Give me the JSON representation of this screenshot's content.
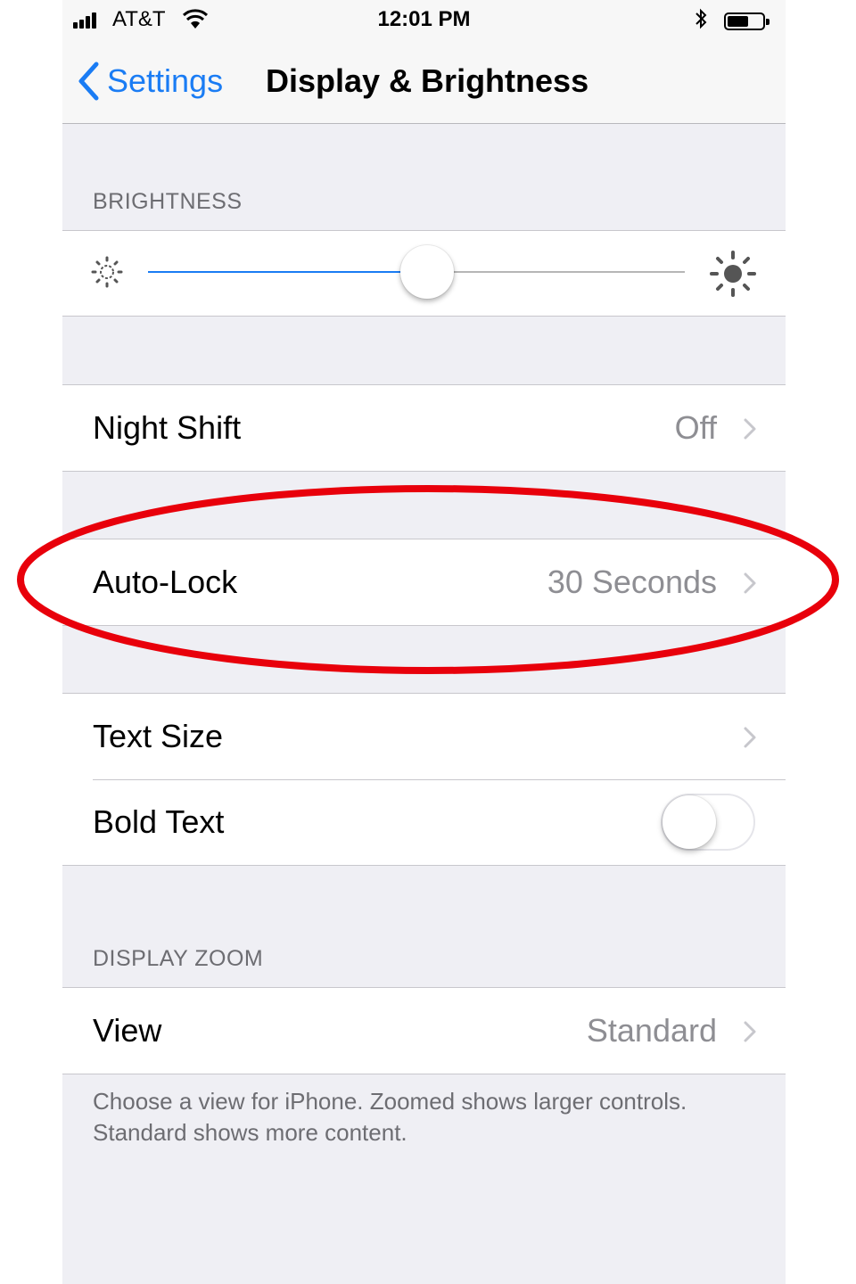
{
  "status_bar": {
    "carrier": "AT&T",
    "time": "12:01 PM",
    "bluetooth_icon": "bluetooth-icon",
    "battery_level": 0.6
  },
  "nav": {
    "back_label": "Settings",
    "title": "Display & Brightness"
  },
  "sections": {
    "brightness_header": "BRIGHTNESS",
    "display_zoom_header": "DISPLAY ZOOM"
  },
  "brightness": {
    "level": 0.52,
    "min_icon": "sun-small-icon",
    "max_icon": "sun-large-icon"
  },
  "rows": {
    "night_shift": {
      "label": "Night Shift",
      "value": "Off"
    },
    "auto_lock": {
      "label": "Auto-Lock",
      "value": "30 Seconds"
    },
    "text_size": {
      "label": "Text Size"
    },
    "bold_text": {
      "label": "Bold Text",
      "enabled": false
    },
    "view": {
      "label": "View",
      "value": "Standard"
    }
  },
  "footer": {
    "zoom_note": "Choose a view for iPhone. Zoomed shows larger controls. Standard shows more content."
  },
  "colors": {
    "accent": "#1a7cf4",
    "annotation": "#e8000b",
    "background": "#efeff4"
  }
}
